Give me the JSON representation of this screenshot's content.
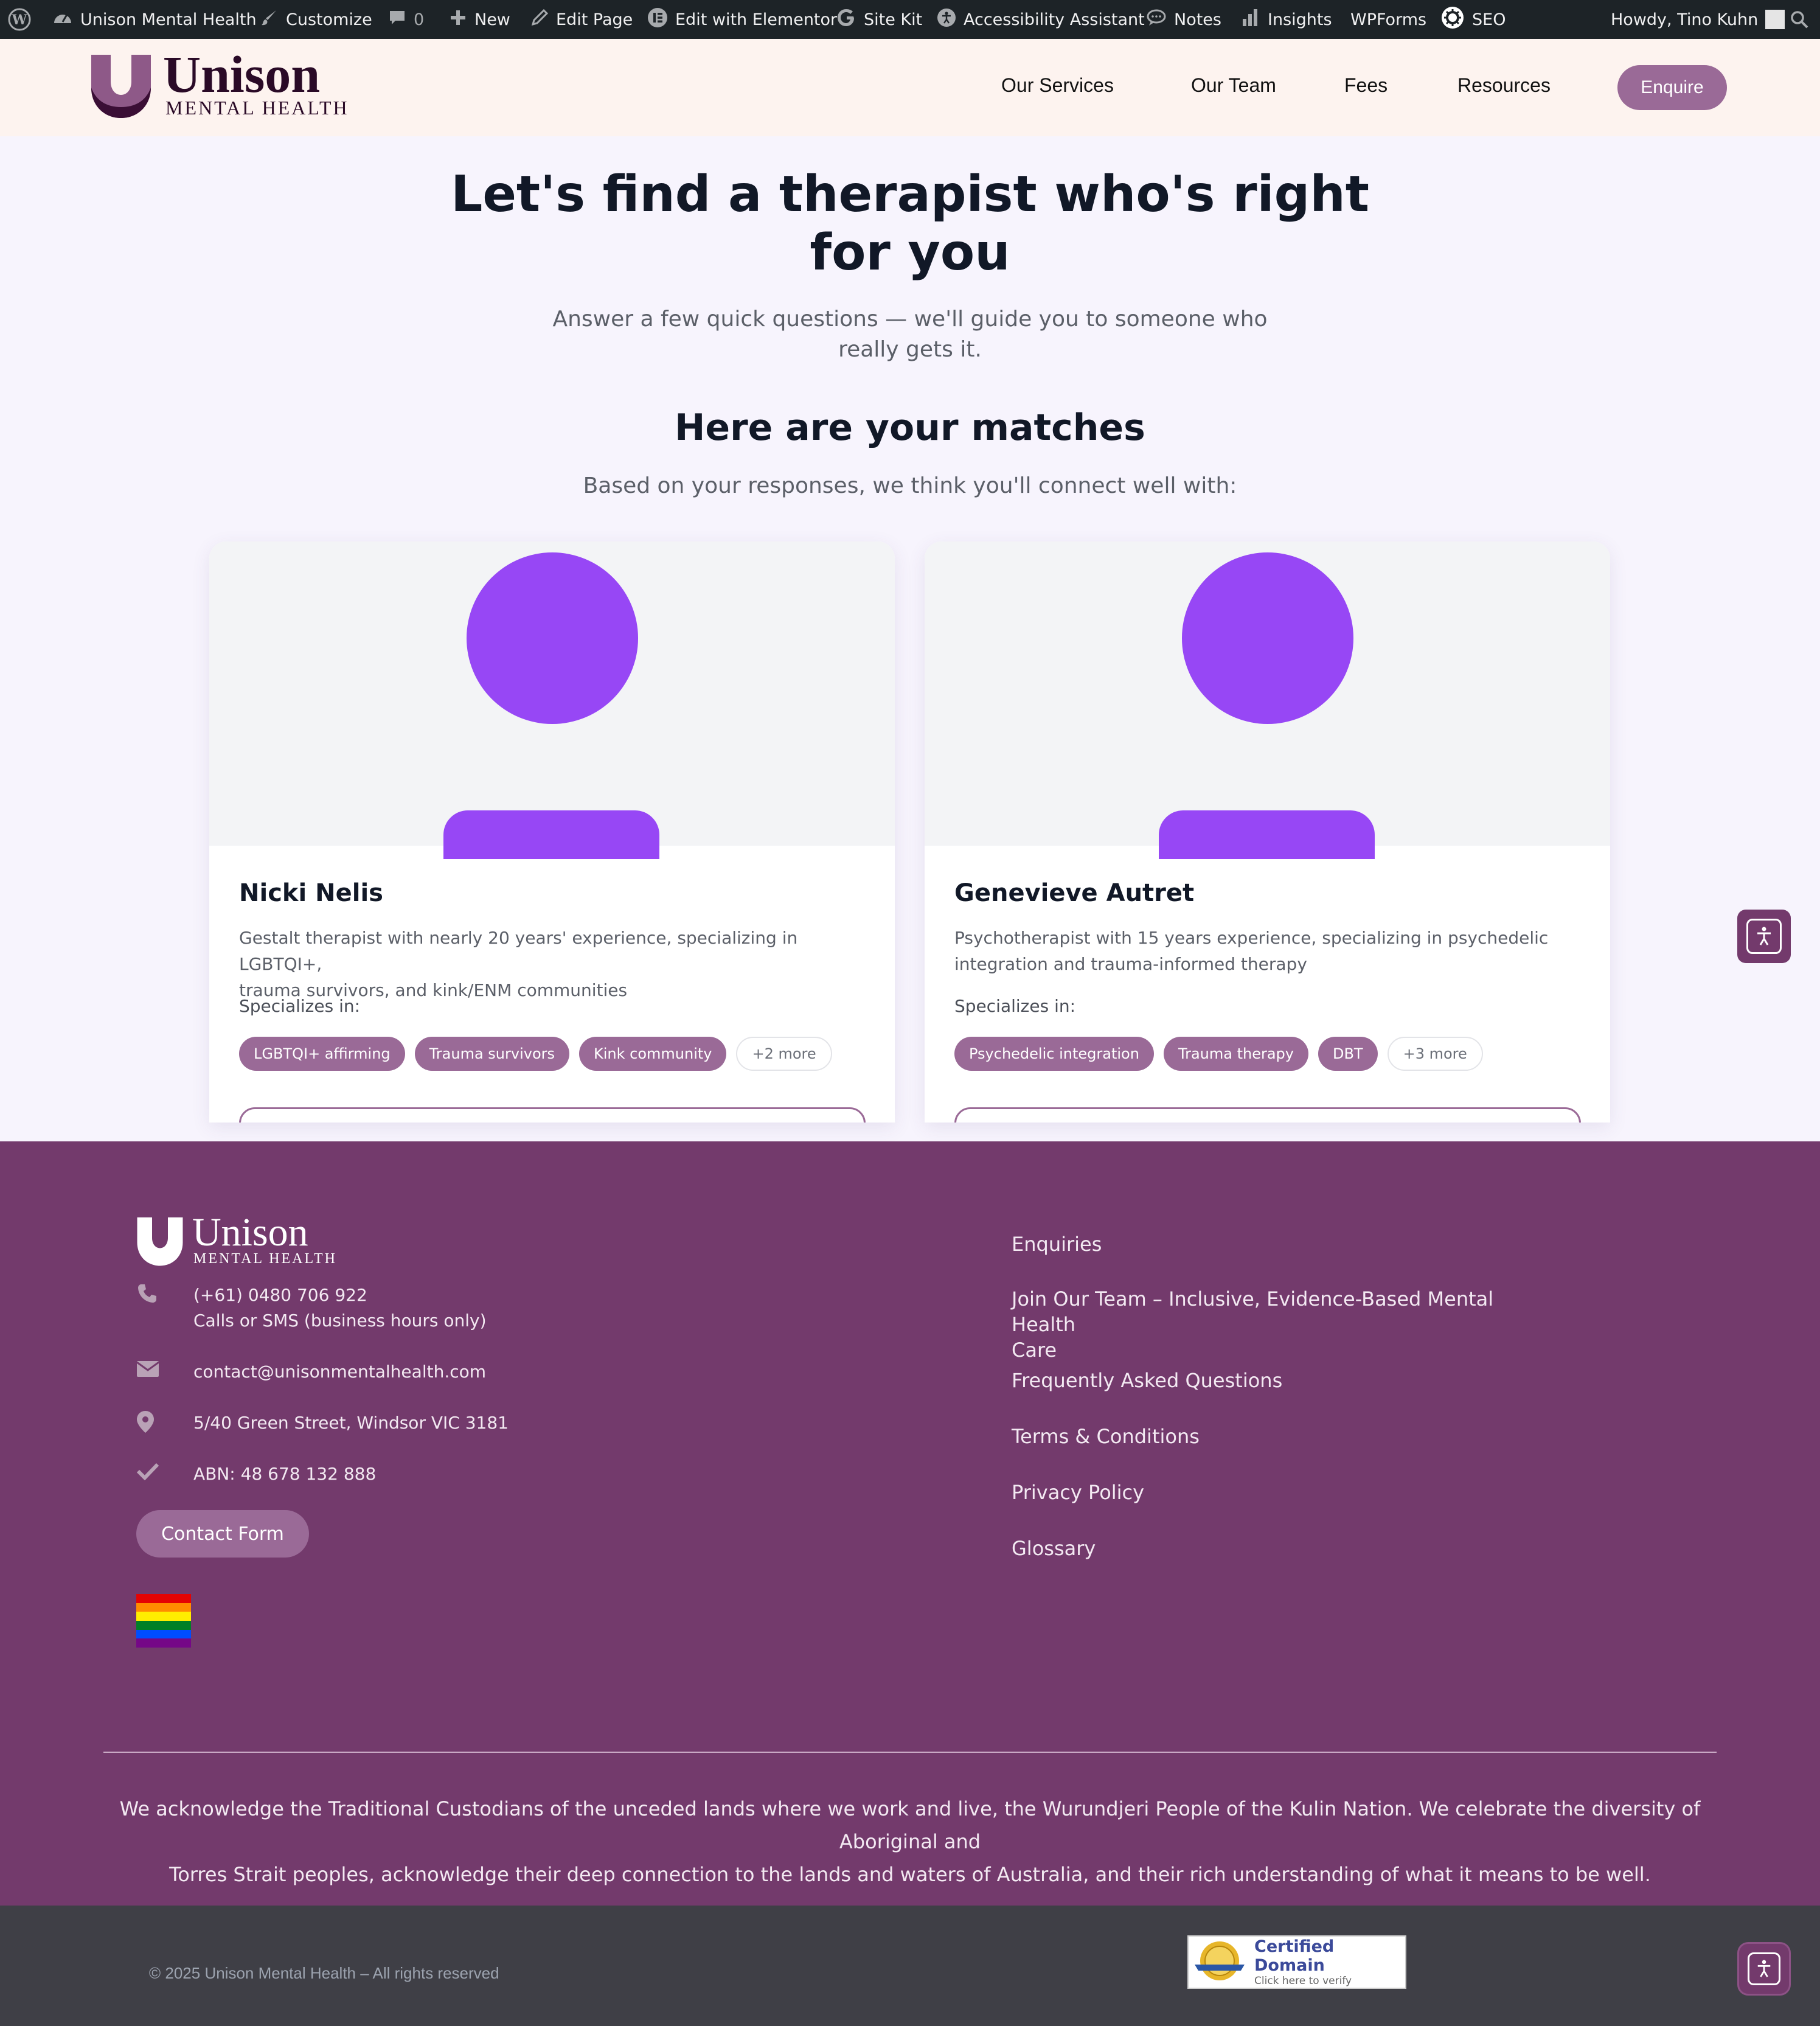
{
  "admin_bar": {
    "site_name": "Unison Mental Health",
    "customize": "Customize",
    "comments_count": "0",
    "new": "New",
    "edit_page": "Edit Page",
    "edit_elementor": "Edit with Elementor",
    "site_kit": "Site Kit",
    "accessibility": "Accessibility Assistant",
    "notes": "Notes",
    "insights": "Insights",
    "wpforms": "WPForms",
    "seo": "SEO",
    "howdy": "Howdy, Tino Kuhn"
  },
  "header": {
    "logo_word": "Unison",
    "logo_sub": "MENTAL HEALTH",
    "nav": [
      "Our Services",
      "Our Team",
      "Fees",
      "Resources"
    ],
    "cta": "Enquire"
  },
  "hero": {
    "title_line1": "Let's find a therapist who's right",
    "title_line2": "for you",
    "subtitle_line1": "Answer a few quick questions — we'll guide you to someone who",
    "subtitle_line2": "really gets it."
  },
  "matches": {
    "title": "Here are your matches",
    "subtitle": "Based on your responses, we think you'll connect well with:",
    "specializes_label": "Specializes in:",
    "cards": [
      {
        "name": "Nicki Nelis",
        "desc_line1": "Gestalt therapist with nearly 20 years' experience, specializing in LGBTQI+,",
        "desc_line2": "trauma survivors, and kink/ENM communities",
        "tags": [
          "LGBTQI+ affirming",
          "Trauma survivors",
          "Kink community"
        ],
        "more": "+2 more"
      },
      {
        "name": "Genevieve Autret",
        "desc_line1": "Psychotherapist with 15 years experience, specializing in psychedelic",
        "desc_line2": "integration and trauma-informed therapy",
        "tags": [
          "Psychedelic integration",
          "Trauma therapy",
          "DBT"
        ],
        "more": "+3 more"
      }
    ]
  },
  "footer": {
    "logo_word": "Unison",
    "logo_sub": "MENTAL HEALTH",
    "phone": "(+61) 0480 706 922",
    "phone_note": "Calls or SMS (business hours only)",
    "email": "contact@unisonmentalhealth.com",
    "address": "5/40 Green Street, Windsor VIC 3181",
    "abn": "ABN: 48 678 132 888",
    "contact_button": "Contact Form",
    "links": [
      "Enquiries",
      "Join Our Team – Inclusive, Evidence-Based Mental Health",
      "Care",
      "Frequently Asked Questions",
      "Terms & Conditions",
      "Privacy Policy",
      "Glossary"
    ],
    "acknowledgement_line1": "We acknowledge the Traditional Custodians of the unceded lands where we work and live, the Wurundjeri People of the Kulin Nation. We celebrate the diversity of Aboriginal and",
    "acknowledgement_line2": "Torres Strait peoples, acknowledge their deep connection to the lands and waters of Australia, and their rich understanding of what it means to be well."
  },
  "bottom_bar": {
    "copyright": "© 2025 Unison Mental Health – All rights reserved",
    "cert_title": "Certified Domain",
    "cert_sub": "Click here to verify"
  },
  "colors": {
    "admin_bar": "#1d2327",
    "header_bg": "#fdf3ef",
    "page_bg": "#f7f4fd",
    "brand_purple": "#733a6c",
    "tag_purple": "#9a6a97",
    "avatar_purple": "#9747f5",
    "bottom_bar": "#3f3f46"
  },
  "icons": [
    "wordpress-icon",
    "dashboard-icon",
    "brush-icon",
    "comment-icon",
    "plus-icon",
    "pencil-icon",
    "elementor-icon",
    "google-icon",
    "accessibility-icon",
    "notes-icon",
    "insights-icon",
    "seo-icon",
    "search-icon",
    "phone-icon",
    "envelope-icon",
    "map-pin-icon",
    "check-icon",
    "pride-flag-icon"
  ]
}
